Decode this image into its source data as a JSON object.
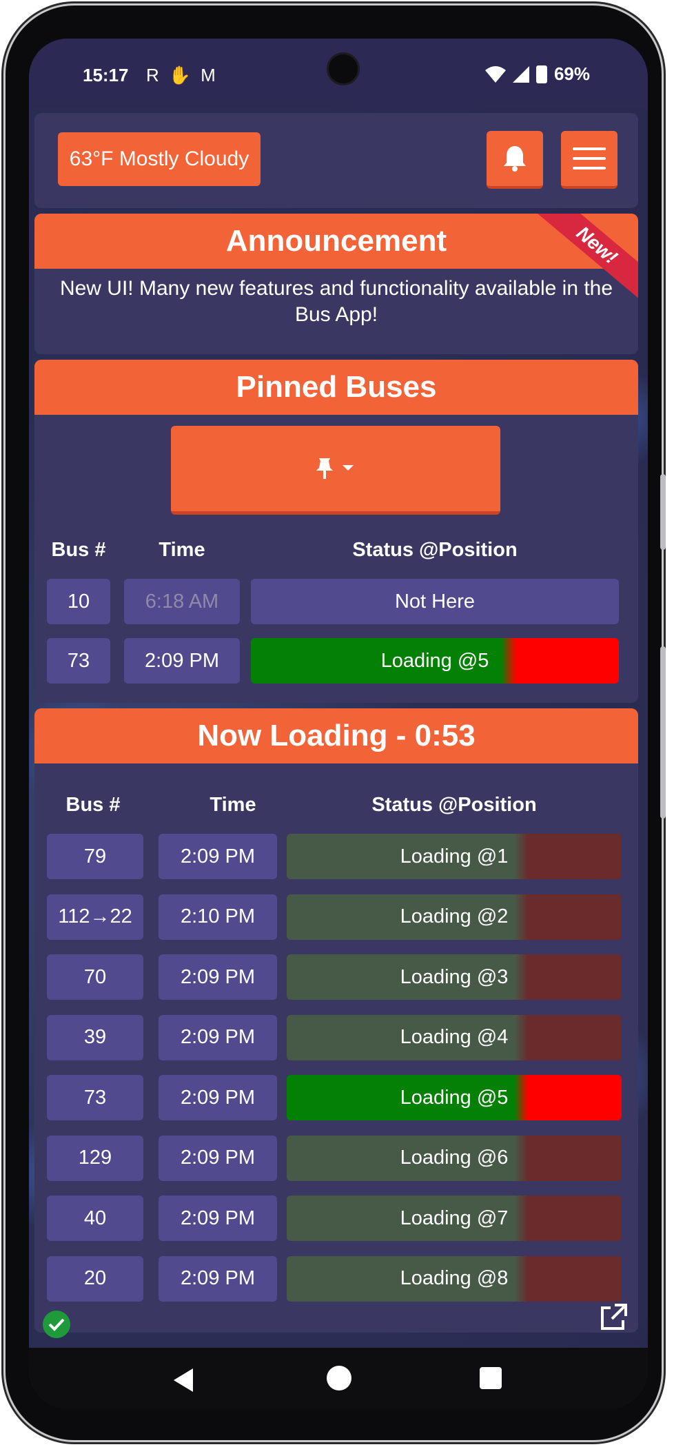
{
  "status_bar": {
    "time": "15:17",
    "notification_icons": [
      "reddit-icon",
      "hand-icon",
      "gmail-icon"
    ],
    "battery": "69%"
  },
  "header": {
    "weather": "63°F Mostly Cloudy",
    "bell_icon": "bell-icon",
    "menu_icon": "hamburger-menu-icon"
  },
  "announcement": {
    "title": "Announcement",
    "ribbon": "New!",
    "text": "New UI! Many new features and functionality available in the Bus App!"
  },
  "pinned": {
    "title": "Pinned Buses",
    "pin_button_icon": "pin-dropdown-icon",
    "columns": [
      "Bus #",
      "Time",
      "Status @Position"
    ],
    "rows": [
      {
        "bus": "10",
        "time": "6:18 AM",
        "status": "Not Here",
        "state": "nothere"
      },
      {
        "bus": "73",
        "time": "2:09 PM",
        "status": "Loading @5",
        "state": "active"
      }
    ]
  },
  "loading": {
    "title": "Now Loading - 0:53",
    "columns": [
      "Bus #",
      "Time",
      "Status @Position"
    ],
    "rows": [
      {
        "bus": "79",
        "time": "2:09 PM",
        "status": "Loading @1",
        "state": "dim"
      },
      {
        "bus": "112→22",
        "time": "2:10 PM",
        "status": "Loading @2",
        "state": "dim"
      },
      {
        "bus": "70",
        "time": "2:09 PM",
        "status": "Loading @3",
        "state": "dim"
      },
      {
        "bus": "39",
        "time": "2:09 PM",
        "status": "Loading @4",
        "state": "dim"
      },
      {
        "bus": "73",
        "time": "2:09 PM",
        "status": "Loading @5",
        "state": "active"
      },
      {
        "bus": "129",
        "time": "2:09 PM",
        "status": "Loading @6",
        "state": "dim"
      },
      {
        "bus": "40",
        "time": "2:09 PM",
        "status": "Loading @7",
        "state": "dim"
      },
      {
        "bus": "20",
        "time": "2:09 PM",
        "status": "Loading @8",
        "state": "dim"
      }
    ]
  },
  "colors": {
    "accent": "#f26337",
    "card": "#3b3763",
    "cell": "#514a8e",
    "loading_green": "#048004",
    "loading_red": "#ff0000"
  }
}
